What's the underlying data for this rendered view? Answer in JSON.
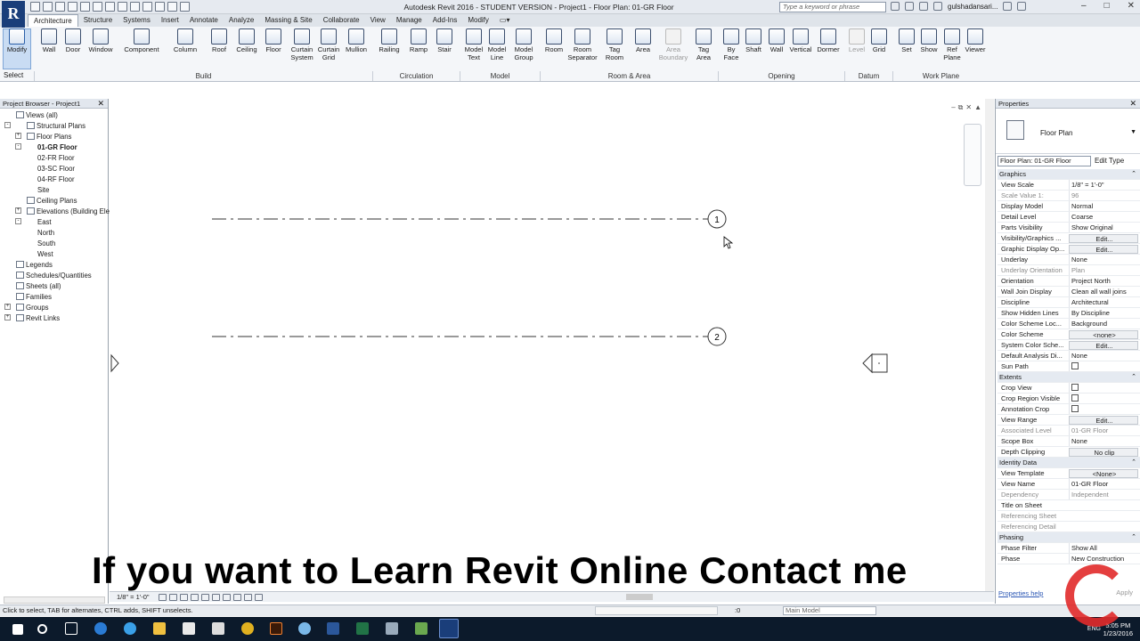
{
  "window": {
    "title": "Autodesk Revit 2016 - STUDENT VERSION -    Project1 - Floor Plan: 01-GR Floor",
    "search_placeholder": "Type a keyword or phrase",
    "user": "gulshadansari...",
    "logo_letter": "R"
  },
  "ribbon_tabs": [
    "Architecture",
    "Structure",
    "Systems",
    "Insert",
    "Annotate",
    "Analyze",
    "Massing & Site",
    "Collaborate",
    "View",
    "Manage",
    "Add-Ins",
    "Modify"
  ],
  "ribbon": {
    "modify": "Modify",
    "select": "Select",
    "build": [
      "Wall",
      "Door",
      "Window",
      "Component",
      "Column",
      "Roof",
      "Ceiling",
      "Floor",
      "Curtain System",
      "Curtain Grid",
      "Mullion"
    ],
    "circulation": [
      "Railing",
      "Ramp",
      "Stair"
    ],
    "model": [
      "Model Text",
      "Model Line",
      "Model Group"
    ],
    "room_area": [
      "Room",
      "Room Separator",
      "Tag Room",
      "Area",
      "Area Boundary",
      "Tag Area"
    ],
    "opening": [
      "By Face",
      "Shaft",
      "Wall",
      "Vertical",
      "Dormer"
    ],
    "datum": [
      "Level",
      "Grid"
    ],
    "work_plane": [
      "Set",
      "Show",
      "Ref Plane",
      "Viewer"
    ],
    "groups": [
      "Build",
      "Circulation",
      "Model",
      "Room & Area",
      "Opening",
      "Datum",
      "Work Plane"
    ]
  },
  "project_browser": {
    "title": "Project Browser - Project1",
    "items": [
      {
        "label": "Views (all)",
        "level": 0,
        "exp": "-"
      },
      {
        "label": "Structural Plans",
        "level": 1,
        "exp": "+"
      },
      {
        "label": "Floor Plans",
        "level": 1,
        "exp": "-"
      },
      {
        "label": "01-GR Floor",
        "level": 2,
        "exp": ""
      },
      {
        "label": "02-FR Floor",
        "level": 2,
        "exp": ""
      },
      {
        "label": "03-SC Floor",
        "level": 2,
        "exp": ""
      },
      {
        "label": "04-RF Floor",
        "level": 2,
        "exp": ""
      },
      {
        "label": "Site",
        "level": 2,
        "exp": ""
      },
      {
        "label": "Ceiling Plans",
        "level": 1,
        "exp": "+"
      },
      {
        "label": "Elevations (Building Elev",
        "level": 1,
        "exp": "-"
      },
      {
        "label": "East",
        "level": 2,
        "exp": ""
      },
      {
        "label": "North",
        "level": 2,
        "exp": ""
      },
      {
        "label": "South",
        "level": 2,
        "exp": ""
      },
      {
        "label": "West",
        "level": 2,
        "exp": ""
      },
      {
        "label": "Legends",
        "level": 0,
        "exp": ""
      },
      {
        "label": "Schedules/Quantities",
        "level": 0,
        "exp": ""
      },
      {
        "label": "Sheets (all)",
        "level": 0,
        "exp": ""
      },
      {
        "label": "Families",
        "level": 0,
        "exp": "+"
      },
      {
        "label": "Groups",
        "level": 0,
        "exp": "+"
      },
      {
        "label": "Revit Links",
        "level": 0,
        "exp": ""
      }
    ],
    "selected": "01-GR Floor"
  },
  "canvas": {
    "grid_labels": [
      "1",
      "2"
    ],
    "promo": "If you want to Learn Revit Online  Contact me"
  },
  "view_control": {
    "scale": "1/8\" = 1'-0\""
  },
  "properties": {
    "title": "Properties",
    "type_name": "Floor Plan",
    "instance": "Floor Plan: 01-GR Floor",
    "edit_type": "Edit Type",
    "rows": [
      {
        "name": "Graphics",
        "section": true
      },
      {
        "name": "View Scale",
        "value": "1/8\" = 1'-0\""
      },
      {
        "name": "Scale Value    1:",
        "value": "96",
        "dim": true
      },
      {
        "name": "Display Model",
        "value": "Normal"
      },
      {
        "name": "Detail Level",
        "value": "Coarse"
      },
      {
        "name": "Parts Visibility",
        "value": "Show Original"
      },
      {
        "name": "Visibility/Graphics ...",
        "value": "Edit...",
        "btn": true
      },
      {
        "name": "Graphic Display Op...",
        "value": "Edit...",
        "btn": true
      },
      {
        "name": "Underlay",
        "value": "None"
      },
      {
        "name": "Underlay Orientation",
        "value": "Plan",
        "dim": true
      },
      {
        "name": "Orientation",
        "value": "Project North"
      },
      {
        "name": "Wall Join Display",
        "value": "Clean all wall joins"
      },
      {
        "name": "Discipline",
        "value": "Architectural"
      },
      {
        "name": "Show Hidden Lines",
        "value": "By Discipline"
      },
      {
        "name": "Color Scheme Loc...",
        "value": "Background"
      },
      {
        "name": "Color Scheme",
        "value": "<none>",
        "btn": true
      },
      {
        "name": "System Color Sche...",
        "value": "Edit...",
        "btn": true
      },
      {
        "name": "Default Analysis Di...",
        "value": "None"
      },
      {
        "name": "Sun Path",
        "value": "",
        "check": true
      },
      {
        "name": "Extents",
        "section": true
      },
      {
        "name": "Crop View",
        "value": "",
        "check": true
      },
      {
        "name": "Crop Region Visible",
        "value": "",
        "check": true
      },
      {
        "name": "Annotation Crop",
        "value": "",
        "check": true
      },
      {
        "name": "View Range",
        "value": "Edit...",
        "btn": true
      },
      {
        "name": "Associated Level",
        "value": "01-GR Floor",
        "dim": true
      },
      {
        "name": "Scope Box",
        "value": "None"
      },
      {
        "name": "Depth Clipping",
        "value": "No clip",
        "btn": true
      },
      {
        "name": "Identity Data",
        "section": true
      },
      {
        "name": "View Template",
        "value": "<None>",
        "btn": true
      },
      {
        "name": "View Name",
        "value": "01-GR Floor"
      },
      {
        "name": "Dependency",
        "value": "Independent",
        "dim": true
      },
      {
        "name": "Title on Sheet",
        "value": ""
      },
      {
        "name": "Referencing Sheet",
        "value": "",
        "dim": true
      },
      {
        "name": "Referencing Detail",
        "value": "",
        "dim": true
      },
      {
        "name": "Phasing",
        "section": true
      },
      {
        "name": "Phase Filter",
        "value": "Show All"
      },
      {
        "name": "Phase",
        "value": "New Construction"
      }
    ],
    "help": "Properties help",
    "apply": "Apply"
  },
  "status": {
    "text": "Click to select, TAB for alternates, CTRL adds, SHIFT unselects.",
    "zero": ":0",
    "workset": "Main Model"
  },
  "taskbar": {
    "lang": "ENG",
    "time": "5:05 PM",
    "date": "1/23/2016"
  }
}
